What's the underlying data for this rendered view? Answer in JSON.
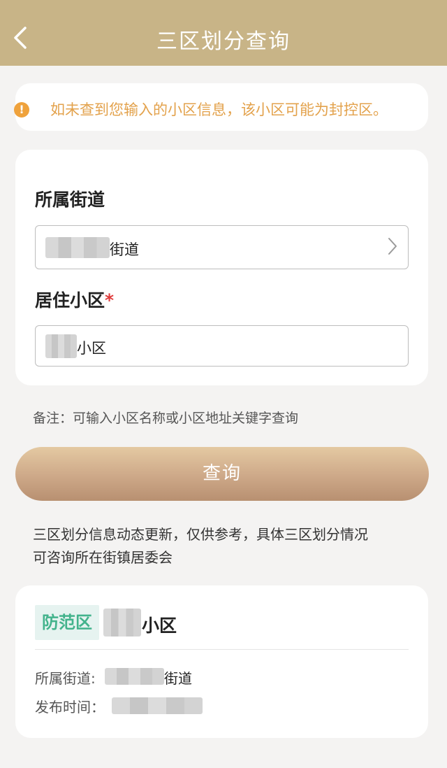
{
  "header": {
    "title": "三区划分查询",
    "back_icon": "chevron-left-icon"
  },
  "notice": {
    "icon": "exclamation-icon",
    "icon_glyph": "!",
    "text": "如未查到您输入的小区信息，该小区可能为封控区。",
    "color": "#e3a24c"
  },
  "form": {
    "street_label": "所属街道",
    "street_value_suffix": "街道",
    "community_label": "居住小区",
    "required_mark": "*",
    "community_value_suffix": "小区"
  },
  "note": "备注：可输入小区名称或小区地址关键字查询",
  "query_button": "查询",
  "info": {
    "line1": "三区划分信息动态更新，仅供参考，具体三区划分情况",
    "line2": "可咨询所在街镇居委会"
  },
  "result": {
    "zone_tag": "防范区",
    "zone_color": "#43b38c",
    "name_suffix": "小区",
    "street_label": "所属街道:",
    "street_value_suffix": "街道",
    "time_label": "发布时间："
  }
}
